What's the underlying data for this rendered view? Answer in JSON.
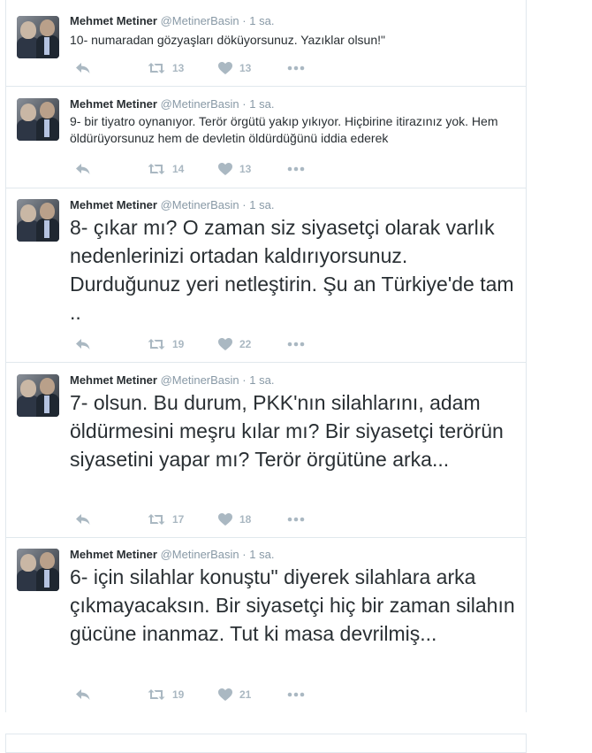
{
  "colors": {
    "name": "#292f33",
    "meta": "#8899a6",
    "action": "#aab8c2",
    "border": "#e1e8ed"
  },
  "icons": {
    "reply": "reply-icon",
    "retweet": "retweet-icon",
    "like": "heart-icon",
    "more": "more-icon"
  },
  "tweets": [
    {
      "fullname": "Mehmet Metiner",
      "username": "@MetinerBasin",
      "separator": "·",
      "time": "1 sa.",
      "text": "10- numaradan gözyaşları döküyorsunuz. Yazıklar olsun!\"",
      "retweets": "13",
      "likes": "13"
    },
    {
      "fullname": "Mehmet Metiner",
      "username": "@MetinerBasin",
      "separator": "·",
      "time": "1 sa.",
      "text": "9- bir tiyatro oynanıyor. Terör örgütü yakıp yıkıyor. Hiçbirine itirazınız yok. Hem öldürüyorsunuz hem de devletin öldürdüğünü iddia ederek",
      "retweets": "14",
      "likes": "13"
    },
    {
      "fullname": "Mehmet Metiner",
      "username": "@MetinerBasin",
      "separator": "·",
      "time": "1 sa.",
      "text": "8- çıkar mı? O zaman siz siyasetçi olarak varlık nedenlerinizi ortadan kaldırıyorsunuz. Durduğunuz yeri netleştirin. Şu an Türkiye'de tam ..",
      "retweets": "19",
      "likes": "22"
    },
    {
      "fullname": "Mehmet Metiner",
      "username": "@MetinerBasin",
      "separator": "·",
      "time": "1 sa.",
      "text": "7- olsun. Bu durum, PKK'nın silahlarını, adam öldürmesini meşru kılar mı? Bir siyasetçi terörün siyasetini yapar mı? Terör örgütüne arka...",
      "retweets": "17",
      "likes": "18"
    },
    {
      "fullname": "Mehmet Metiner",
      "username": "@MetinerBasin",
      "separator": "·",
      "time": "1 sa.",
      "text": "6- için silahlar konuştu\" diyerek silahlara arka çıkmayacaksın. Bir siyasetçi hiç bir zaman silahın gücüne inanmaz. Tut ki masa devrilmiş...",
      "retweets": "19",
      "likes": "21"
    }
  ]
}
